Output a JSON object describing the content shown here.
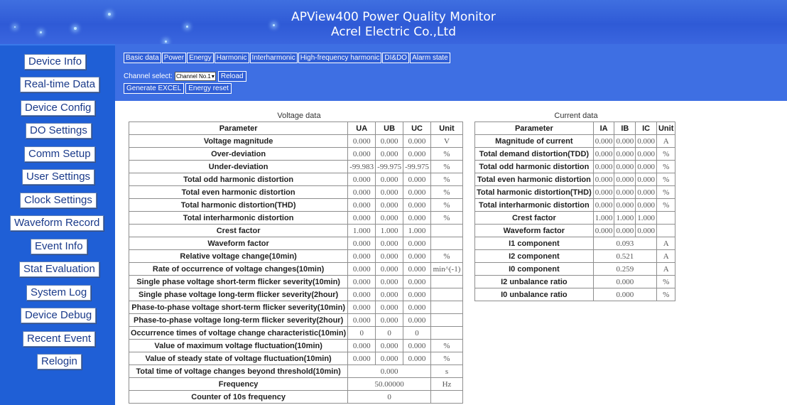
{
  "header": {
    "title": "APView400 Power Quality Monitor",
    "subtitle": "Acrel Electric Co.,Ltd"
  },
  "sidebar": {
    "items": [
      {
        "label": "Device Info"
      },
      {
        "label": "Real-time Data"
      },
      {
        "label": "Device Config"
      },
      {
        "label": "DO Settings"
      },
      {
        "label": "Comm Setup"
      },
      {
        "label": "User Settings"
      },
      {
        "label": "Clock Settings"
      },
      {
        "label": "Waveform Record"
      },
      {
        "label": "Event Info"
      },
      {
        "label": "Stat Evaluation"
      },
      {
        "label": "System Log"
      },
      {
        "label": "Device Debug"
      },
      {
        "label": "Recent Event"
      },
      {
        "label": "Relogin"
      }
    ]
  },
  "tabs": [
    {
      "label": "Basic data"
    },
    {
      "label": "Power"
    },
    {
      "label": "Energy"
    },
    {
      "label": "Harmonic"
    },
    {
      "label": "Interharmonic"
    },
    {
      "label": "High-frequency harmonic"
    },
    {
      "label": "DI&DO"
    },
    {
      "label": "Alarm state"
    }
  ],
  "controls": {
    "channel_label": "Channel select:",
    "channel_value": "Channel No.1",
    "channel_arrow": "▾",
    "reload": "Reload",
    "generate_excel": "Generate EXCEL",
    "energy_reset": "Energy reset"
  },
  "voltage": {
    "caption": "Voltage data",
    "headers": [
      "Parameter",
      "UA",
      "UB",
      "UC",
      "Unit"
    ],
    "rows": [
      {
        "p": "Voltage magnitude",
        "a": "0.000",
        "b": "0.000",
        "c": "0.000",
        "u": "V"
      },
      {
        "p": "Over-deviation",
        "a": "0.000",
        "b": "0.000",
        "c": "0.000",
        "u": "%"
      },
      {
        "p": "Under-deviation",
        "a": "-99.983",
        "b": "-99.975",
        "c": "-99.975",
        "u": "%"
      },
      {
        "p": "Total odd harmonic distortion",
        "a": "0.000",
        "b": "0.000",
        "c": "0.000",
        "u": "%"
      },
      {
        "p": "Total even harmonic distortion",
        "a": "0.000",
        "b": "0.000",
        "c": "0.000",
        "u": "%"
      },
      {
        "p": "Total harmonic distortion(THD)",
        "a": "0.000",
        "b": "0.000",
        "c": "0.000",
        "u": "%"
      },
      {
        "p": "Total interharmonic distortion",
        "a": "0.000",
        "b": "0.000",
        "c": "0.000",
        "u": "%"
      },
      {
        "p": "Crest factor",
        "a": "1.000",
        "b": "1.000",
        "c": "1.000",
        "u": ""
      },
      {
        "p": "Waveform factor",
        "a": "0.000",
        "b": "0.000",
        "c": "0.000",
        "u": ""
      },
      {
        "p": "Relative voltage change(10min)",
        "a": "0.000",
        "b": "0.000",
        "c": "0.000",
        "u": "%"
      },
      {
        "p": "Rate of occurrence of voltage changes(10min)",
        "a": "0.000",
        "b": "0.000",
        "c": "0.000",
        "u": "min^(-1)"
      },
      {
        "p": "Single phase voltage short-term flicker severity(10min)",
        "a": "0.000",
        "b": "0.000",
        "c": "0.000",
        "u": ""
      },
      {
        "p": "Single phase voltage long-term flicker severity(2hour)",
        "a": "0.000",
        "b": "0.000",
        "c": "0.000",
        "u": ""
      },
      {
        "p": "Phase-to-phase voltage short-term flicker severity(10min)",
        "a": "0.000",
        "b": "0.000",
        "c": "0.000",
        "u": ""
      },
      {
        "p": "Phase-to-phase voltage long-term flicker severity(2hour)",
        "a": "0.000",
        "b": "0.000",
        "c": "0.000",
        "u": ""
      },
      {
        "p": "Occurrence times of voltage change characteristic(10min)",
        "a": "0",
        "b": "0",
        "c": "0",
        "u": ""
      },
      {
        "p": "Value of maximum voltage fluctuation(10min)",
        "a": "0.000",
        "b": "0.000",
        "c": "0.000",
        "u": "%"
      },
      {
        "p": "Value of steady state of voltage fluctuation(10min)",
        "a": "0.000",
        "b": "0.000",
        "c": "0.000",
        "u": "%"
      }
    ],
    "merged_rows": [
      {
        "p": "Total time of voltage changes beyond threshold(10min)",
        "v": "0.000",
        "u": "s"
      },
      {
        "p": "Frequency",
        "v": "50.00000",
        "u": "Hz"
      },
      {
        "p": "Counter of 10s frequency",
        "v": "0",
        "u": ""
      }
    ]
  },
  "current": {
    "caption": "Current data",
    "headers": [
      "Parameter",
      "IA",
      "IB",
      "IC",
      "Unit"
    ],
    "rows": [
      {
        "p": "Magnitude of current",
        "a": "0.000",
        "b": "0.000",
        "c": "0.000",
        "u": "A"
      },
      {
        "p": "Total demand distortion(TDD)",
        "a": "0.000",
        "b": "0.000",
        "c": "0.000",
        "u": "%"
      },
      {
        "p": "Total odd harmonic distortion",
        "a": "0.000",
        "b": "0.000",
        "c": "0.000",
        "u": "%"
      },
      {
        "p": "Total even harmonic distortion",
        "a": "0.000",
        "b": "0.000",
        "c": "0.000",
        "u": "%"
      },
      {
        "p": "Total harmonic distortion(THD)",
        "a": "0.000",
        "b": "0.000",
        "c": "0.000",
        "u": "%"
      },
      {
        "p": "Total interharmonic distortion",
        "a": "0.000",
        "b": "0.000",
        "c": "0.000",
        "u": "%"
      },
      {
        "p": "Crest factor",
        "a": "1.000",
        "b": "1.000",
        "c": "1.000",
        "u": ""
      },
      {
        "p": "Waveform factor",
        "a": "0.000",
        "b": "0.000",
        "c": "0.000",
        "u": ""
      }
    ],
    "merged_rows": [
      {
        "p": "I1 component",
        "v": "0.093",
        "u": "A"
      },
      {
        "p": "I2 component",
        "v": "0.521",
        "u": "A"
      },
      {
        "p": "I0 component",
        "v": "0.259",
        "u": "A"
      },
      {
        "p": "I2 unbalance ratio",
        "v": "0.000",
        "u": "%"
      },
      {
        "p": "I0 unbalance ratio",
        "v": "0.000",
        "u": "%"
      }
    ]
  }
}
